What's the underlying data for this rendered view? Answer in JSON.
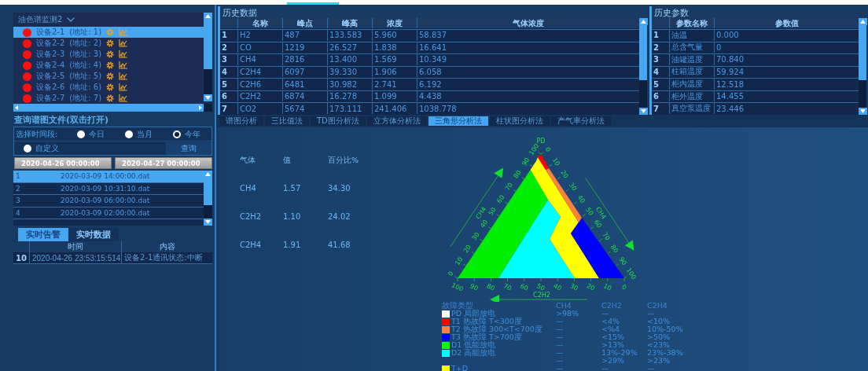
{
  "devices": {
    "title": "油色谱监测2",
    "items": [
      {
        "name": "设备2-1",
        "address": "(地址: 1)",
        "selected": true
      },
      {
        "name": "设备2-2",
        "address": "(地址: 2)",
        "selected": false
      },
      {
        "name": "设备2-3",
        "address": "(地址: 3)",
        "selected": false
      },
      {
        "name": "设备2-4",
        "address": "(地址: 4)",
        "selected": false
      },
      {
        "name": "设备2-5",
        "address": "(地址: 5)",
        "selected": false
      },
      {
        "name": "设备2-6",
        "address": "(地址: 6)",
        "selected": false
      },
      {
        "name": "设备2-7",
        "address": "(地址: 7)",
        "selected": false
      }
    ]
  },
  "file_query": {
    "title": "查询谱图文件(双击打开)",
    "period_label": "选择时间段:",
    "periods": [
      {
        "label": "今日",
        "selected": false
      },
      {
        "label": "当月",
        "selected": false
      },
      {
        "label": "今年",
        "selected": true
      },
      {
        "label": "自定义",
        "selected": false
      }
    ],
    "query_button": "查询",
    "start": "2020-04-26 00:00:00",
    "end": "2020-04-27 00:00:00",
    "files": [
      {
        "index": "1",
        "name": "2020-03-09 14:00:00.dat",
        "selected": true
      },
      {
        "index": "2",
        "name": "2020-03-09 10:31:10.dat",
        "selected": false
      },
      {
        "index": "3",
        "name": "2020-03-09 06:00:00.dat",
        "selected": false
      },
      {
        "index": "4",
        "name": "2020-03-09 02:00:00.dat",
        "selected": false
      }
    ]
  },
  "alarm_tabs": [
    {
      "label": "实时告警",
      "selected": true
    },
    {
      "label": "实时数据",
      "selected": false
    }
  ],
  "alarms": {
    "columns": [
      "时间",
      "内容"
    ],
    "rows": [
      {
        "index": "10",
        "time": "2020-04-26 23:53:15:514",
        "content": "设备2-1通讯状态:中断"
      }
    ]
  },
  "history": {
    "title": "历史数据",
    "columns": [
      "名称",
      "峰点",
      "峰高",
      "浓度",
      "气体浓度"
    ],
    "rows": [
      {
        "index": "1",
        "cells": [
          "H2",
          "487",
          "133.583",
          "5.960",
          "58.837"
        ]
      },
      {
        "index": "2",
        "cells": [
          "CO",
          "1219",
          "26.527",
          "1.838",
          "16.641"
        ]
      },
      {
        "index": "3",
        "cells": [
          "CH4",
          "2816",
          "13.400",
          "1.569",
          "10.349"
        ]
      },
      {
        "index": "4",
        "cells": [
          "C2H4",
          "6097",
          "39.330",
          "1.906",
          "6.058"
        ]
      },
      {
        "index": "5",
        "cells": [
          "C2H6",
          "6481",
          "30.982",
          "2.741",
          "6.192"
        ]
      },
      {
        "index": "6",
        "cells": [
          "C2H2",
          "6874",
          "16.278",
          "1.099",
          "4.438"
        ]
      },
      {
        "index": "7",
        "cells": [
          "CO2",
          "5674",
          "173.111",
          "241.406",
          "1038.778"
        ]
      }
    ]
  },
  "params": {
    "title": "历史参数",
    "columns": [
      "参数名称",
      "参数值"
    ],
    "rows": [
      {
        "index": "1",
        "cells": [
          "油温",
          "0.000"
        ]
      },
      {
        "index": "2",
        "cells": [
          "总含气量",
          "0"
        ]
      },
      {
        "index": "3",
        "cells": [
          "油罐温度",
          "70.840"
        ]
      },
      {
        "index": "4",
        "cells": [
          "柱箱温度",
          "59.924"
        ]
      },
      {
        "index": "5",
        "cells": [
          "柜内温度",
          "12.518"
        ]
      },
      {
        "index": "6",
        "cells": [
          "柜外温度",
          "14.455"
        ]
      },
      {
        "index": "7",
        "cells": [
          "真空泵温度",
          "23.446"
        ]
      }
    ]
  },
  "analysis_tabs": [
    {
      "label": "谱图分析",
      "selected": false
    },
    {
      "label": "三比值法",
      "selected": false
    },
    {
      "label": "TD图分析法",
      "selected": false
    },
    {
      "label": "立方体分析法",
      "selected": false
    },
    {
      "label": "三角形分析法",
      "selected": true
    },
    {
      "label": "柱状图分析法",
      "selected": false
    },
    {
      "label": "产气率分析法",
      "selected": false
    }
  ],
  "gas_table": {
    "columns": [
      "气体",
      "值",
      "百分比%"
    ],
    "rows": [
      [
        "CH4",
        "1.57",
        "34.30"
      ],
      [
        "C2H2",
        "1.10",
        "24.02"
      ],
      [
        "C2H4",
        "1.91",
        "41.68"
      ]
    ]
  },
  "triangle": {
    "top_label": "PD",
    "left_axis": "CH4",
    "right_axis": "CH4",
    "bottom_axis": "C2H2",
    "left_ticks": [
      "0",
      "10",
      "20",
      "30",
      "40",
      "50",
      "60",
      "70",
      "80",
      "90",
      "100"
    ],
    "right_ticks": [
      "0",
      "10",
      "20",
      "30",
      "40",
      "50",
      "60",
      "70",
      "80",
      "90",
      "100"
    ],
    "bottom_ticks": [
      "100",
      "90",
      "80",
      "70",
      "60",
      "50",
      "40",
      "30",
      "20",
      "10",
      "0"
    ]
  },
  "legend": {
    "columns": [
      "故障类型",
      "CH4",
      "C2H2",
      "C2H4"
    ],
    "rows": [
      {
        "label": "PD 局部放电",
        "color": "#ffffff",
        "values": [
          ">98%",
          "—",
          "—"
        ]
      },
      {
        "label": "T1 热故障 T<300度",
        "color": "#ff0000",
        "values": [
          "—",
          "<4%",
          "<10%"
        ]
      },
      {
        "label": "T2 热故障 300<T<700度",
        "color": "#ff8040",
        "values": [
          "—",
          "<%4",
          "10%-50%"
        ]
      },
      {
        "label": "T3 热故障 T>700度",
        "color": "#0000ff",
        "values": [
          "—",
          "<15%",
          ">50%"
        ]
      },
      {
        "label": "D1 低能放电",
        "color": "#00ff00",
        "values": [
          "—",
          ">13%",
          "<23%"
        ]
      },
      {
        "label": "D2 高能放电",
        "color": "#00ffff",
        "values": [
          "—",
          "13%-29%",
          "23%-38%"
        ]
      },
      {
        "values": [
          "—",
          ">29%",
          ">23%"
        ]
      },
      {
        "label": "T+D",
        "color": "#ffff00",
        "values": [
          "—",
          "—",
          "—"
        ]
      }
    ]
  }
}
